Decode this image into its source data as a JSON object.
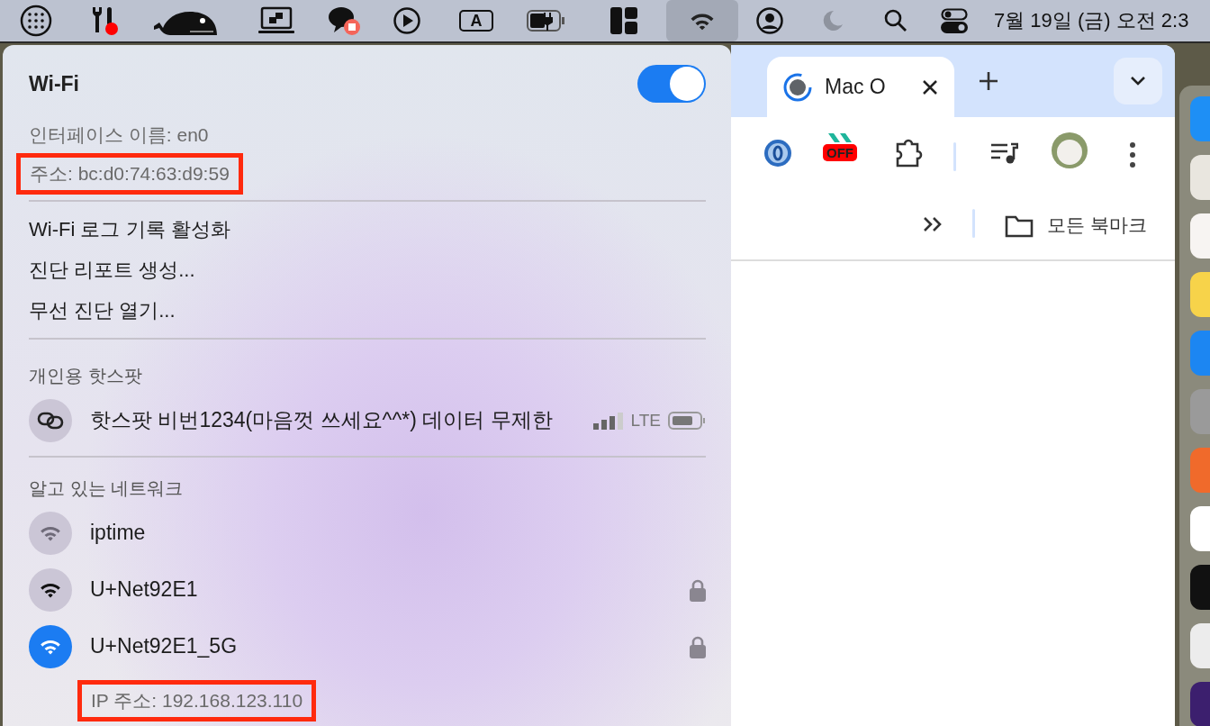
{
  "menu_bar": {
    "input_source": "A",
    "wifi_selected": true,
    "clock": "7월 19일 (금) 오전 2:3"
  },
  "wifi_panel": {
    "title": "Wi-Fi",
    "on": true,
    "info": [
      {
        "text": "인터페이스 이름: en0",
        "highlighted": false
      },
      {
        "text": "주소: bc:d0:74:63:d9:59",
        "highlighted": true
      }
    ],
    "actions": [
      "Wi-Fi 로그 기록 활성화",
      "진단 리포트 생성...",
      "무선 진단 열기..."
    ],
    "hotspot": {
      "heading": "개인용 핫스팟",
      "name": "핫스팟 비번1234(마음껏 쓰세요^^*) 데이터 무제한",
      "network": "LTE"
    },
    "known": {
      "heading": "알고 있는 네트워크",
      "networks": [
        {
          "name": "iptime",
          "connected": false,
          "dimmed": true,
          "locked": false
        },
        {
          "name": "U+Net92E1",
          "connected": false,
          "dimmed": false,
          "locked": true
        },
        {
          "name": "U+Net92E1_5G",
          "connected": true,
          "dimmed": false,
          "locked": true,
          "ip": "IP 주소: 192.168.123.110",
          "ip_highlighted": true
        }
      ]
    }
  },
  "browser": {
    "tab": {
      "title": "Mac O",
      "selected": true
    },
    "extension_badge": "OFF",
    "bookmarks": "모든 북마크"
  }
}
